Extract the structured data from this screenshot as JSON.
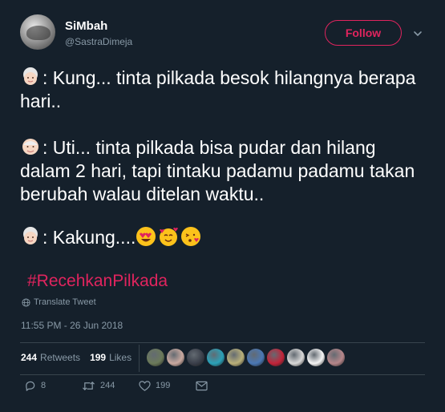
{
  "header": {
    "display_name": "SiMbah",
    "handle": "@SastraDimeja",
    "follow_label": "Follow"
  },
  "tweet": {
    "line1_text": ": Kung... tinta pilkada besok hilangnya berapa hari..",
    "line2_text": ": Uti... tinta pilkada bisa pudar dan hilang dalam 2 hari, tapi tintaku padamu padamu takan berubah walau ditelan waktu..",
    "line3_text": ": Kakung....",
    "hashtag": "#RecehkanPilkada",
    "translate_label": "Translate Tweet",
    "timestamp": "11:55 PM - 26 Jun 2018"
  },
  "stats": {
    "retweets_count": "244",
    "retweets_label": "Retweets",
    "likes_count": "199",
    "likes_label": "Likes"
  },
  "likers": [
    {
      "color": "#6b7a5a"
    },
    {
      "color": "#c9a9a0"
    },
    {
      "color": "#3a3f4a"
    },
    {
      "color": "#2aa1b8"
    },
    {
      "color": "#b9b07a"
    },
    {
      "color": "#4a78b5"
    },
    {
      "color": "#c2243a"
    },
    {
      "color": "#d8d8d8"
    },
    {
      "color": "#f5f5f5"
    },
    {
      "color": "#b5868a"
    }
  ],
  "actions": {
    "reply_count": "8",
    "retweet_count": "244",
    "like_count": "199"
  },
  "colors": {
    "background": "#15202b",
    "accent": "#e0245e",
    "muted": "#8899a6",
    "divider": "#38444d"
  },
  "icons": {
    "caret": "chevron-down-icon",
    "emoji_grandma": "old-woman-emoji",
    "emoji_grandpa": "old-man-emoji",
    "emoji_heart_eyes": "heart-eyes-emoji",
    "emoji_hearts_face": "smiling-face-with-hearts-emoji",
    "emoji_kiss": "face-blowing-kiss-emoji",
    "globe": "globe-icon",
    "reply": "reply-icon",
    "retweet": "retweet-icon",
    "like": "heart-icon",
    "dm": "envelope-icon"
  }
}
